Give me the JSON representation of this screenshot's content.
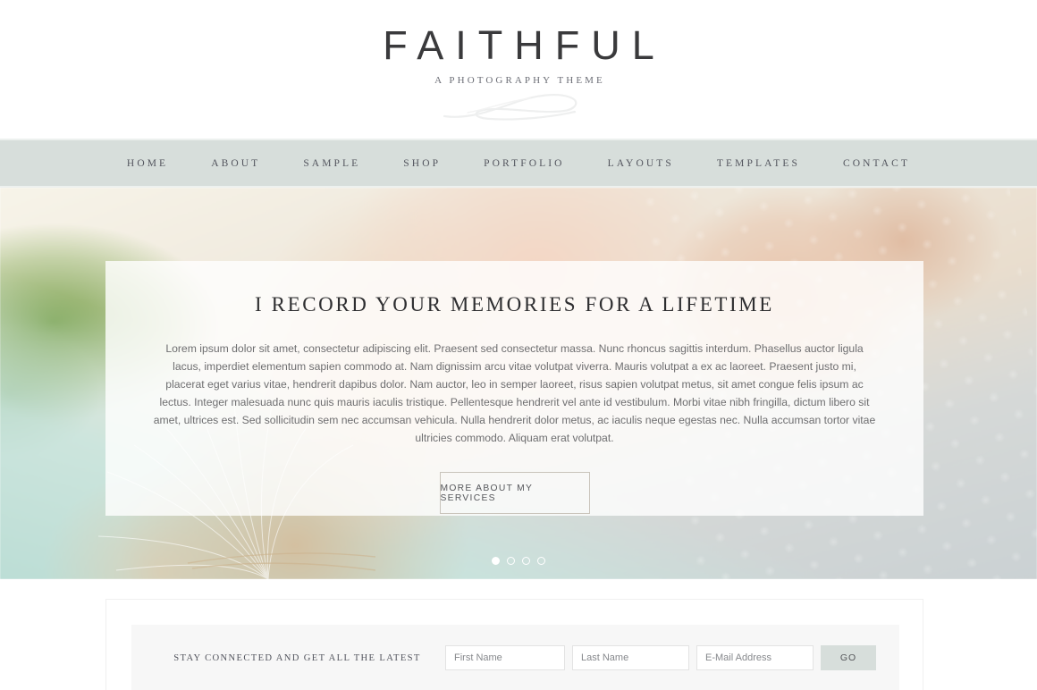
{
  "header": {
    "logo_title": "FAITHFUL",
    "logo_tagline": "A PHOTOGRAPHY THEME",
    "flourish_icon": "calligraphic-swash-icon"
  },
  "nav": {
    "items": [
      {
        "label": "HOME"
      },
      {
        "label": "ABOUT"
      },
      {
        "label": "SAMPLE"
      },
      {
        "label": "SHOP"
      },
      {
        "label": "PORTFOLIO"
      },
      {
        "label": "LAYOUTS"
      },
      {
        "label": "TEMPLATES"
      },
      {
        "label": "CONTACT"
      }
    ]
  },
  "hero": {
    "title": "I RECORD YOUR MEMORIES FOR A LIFETIME",
    "body": "Lorem ipsum dolor sit amet, consectetur adipiscing elit. Praesent sed consectetur massa. Nunc rhoncus sagittis interdum. Phasellus auctor ligula lacus, imperdiet elementum sapien commodo at. Nam dignissim arcu vitae volutpat viverra. Mauris volutpat a ex ac laoreet. Praesent justo mi, placerat eget varius vitae, hendrerit dapibus dolor. Nam auctor, leo in semper laoreet, risus sapien volutpat metus, sit amet congue felis ipsum ac lectus. Integer malesuada nunc quis mauris iaculis tristique. Pellentesque hendrerit vel ante id vestibulum. Morbi vitae nibh fringilla, dictum libero sit amet, ultrices est. Sed sollicitudin sem nec accumsan vehicula. Nulla hendrerit dolor metus, ac iaculis neque egestas nec. Nulla accumsan tortor vitae ultricies commodo. Aliquam erat volutpat.",
    "cta_label": "MORE ABOUT MY SERVICES",
    "slider_dots": [
      {
        "active": true
      },
      {
        "active": false
      },
      {
        "active": false
      },
      {
        "active": false
      }
    ]
  },
  "newsletter": {
    "label": "STAY CONNECTED AND GET ALL THE LATEST",
    "first_name_placeholder": "First Name",
    "first_name_value": "",
    "last_name_placeholder": "Last Name",
    "last_name_value": "",
    "email_placeholder": "E-Mail Address",
    "email_value": "",
    "submit_label": "GO"
  },
  "colors": {
    "nav_bg": "#d7dedb",
    "nav_text": "#53555e",
    "logo_text": "#3a3a3c",
    "hero_overlay": "rgba(255,255,255,0.80)",
    "newsletter_bg": "#f7f7f7",
    "button_bg": "#d7dedb"
  }
}
